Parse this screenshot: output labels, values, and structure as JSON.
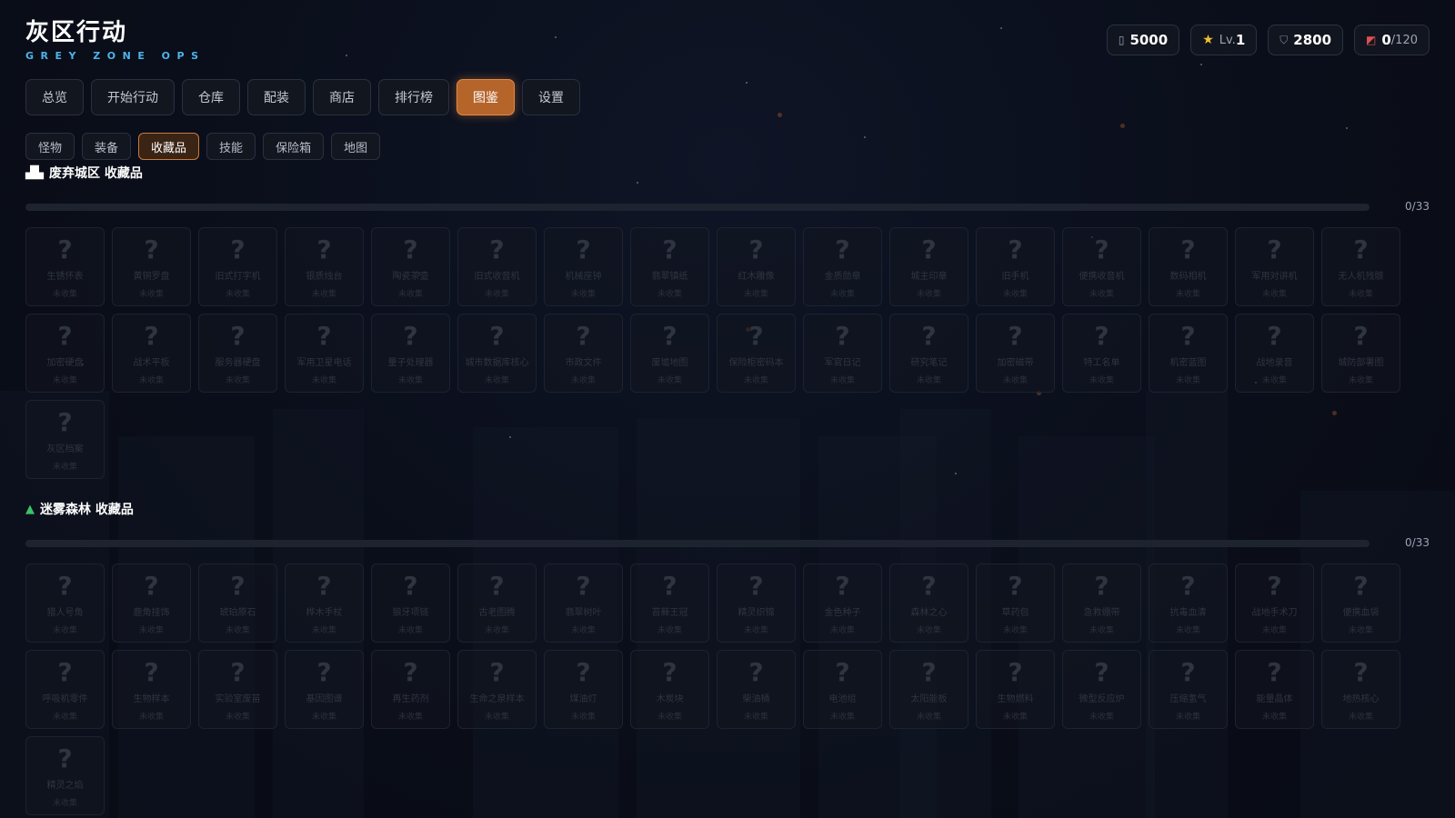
{
  "app": {
    "title": "灰区行动",
    "subtitle": "GREY ZONE OPS"
  },
  "stats": {
    "gold": "5000",
    "level_prefix": "Lv.",
    "level": "1",
    "shield": "2800",
    "bag_used": "0",
    "bag_capacity": "/120"
  },
  "main_tabs": [
    "总览",
    "开始行动",
    "仓库",
    "配装",
    "商店",
    "排行榜",
    "图鉴",
    "设置"
  ],
  "main_tab_active": "图鉴",
  "sub_tabs": [
    "怪物",
    "装备",
    "收藏品",
    "技能",
    "保险箱",
    "地图"
  ],
  "sub_tab_active": "收藏品",
  "sections": [
    {
      "title": "废弃城区 收藏品",
      "icon": "city-icon",
      "collected": 0,
      "total": 33,
      "count_text": "0/33",
      "items": [
        {
          "name": "生锈怀表",
          "status": "未收集"
        },
        {
          "name": "黄铜罗盘",
          "status": "未收集"
        },
        {
          "name": "旧式打字机",
          "status": "未收集"
        },
        {
          "name": "银质烛台",
          "status": "未收集"
        },
        {
          "name": "陶瓷茶壶",
          "status": "未收集"
        },
        {
          "name": "旧式收音机",
          "status": "未收集"
        },
        {
          "name": "机械座钟",
          "status": "未收集"
        },
        {
          "name": "翡翠镇纸",
          "status": "未收集"
        },
        {
          "name": "红木雕像",
          "status": "未收集"
        },
        {
          "name": "金质勋章",
          "status": "未收集"
        },
        {
          "name": "城主印章",
          "status": "未收集"
        },
        {
          "name": "旧手机",
          "status": "未收集"
        },
        {
          "name": "便携收音机",
          "status": "未收集"
        },
        {
          "name": "数码相机",
          "status": "未收集"
        },
        {
          "name": "军用对讲机",
          "status": "未收集"
        },
        {
          "name": "无人机残骸",
          "status": "未收集"
        },
        {
          "name": "加密硬盘",
          "status": "未收集"
        },
        {
          "name": "战术平板",
          "status": "未收集"
        },
        {
          "name": "服务器硬盘",
          "status": "未收集"
        },
        {
          "name": "军用卫星电话",
          "status": "未收集"
        },
        {
          "name": "量子处理器",
          "status": "未收集"
        },
        {
          "name": "城市数据库核心",
          "status": "未收集"
        },
        {
          "name": "市政文件",
          "status": "未收集"
        },
        {
          "name": "废墟地图",
          "status": "未收集"
        },
        {
          "name": "保险柜密码本",
          "status": "未收集"
        },
        {
          "name": "军官日记",
          "status": "未收集"
        },
        {
          "name": "研究笔记",
          "status": "未收集"
        },
        {
          "name": "加密磁带",
          "status": "未收集"
        },
        {
          "name": "特工名单",
          "status": "未收集"
        },
        {
          "name": "机密蓝图",
          "status": "未收集"
        },
        {
          "name": "战地录音",
          "status": "未收集"
        },
        {
          "name": "城防部署图",
          "status": "未收集"
        },
        {
          "name": "灰区档案",
          "status": "未收集"
        }
      ]
    },
    {
      "title": "迷雾森林 收藏品",
      "icon": "tree-icon",
      "collected": 0,
      "total": 33,
      "count_text": "0/33",
      "items": [
        {
          "name": "猎人号角",
          "status": "未收集"
        },
        {
          "name": "鹿角挂饰",
          "status": "未收集"
        },
        {
          "name": "琥珀原石",
          "status": "未收集"
        },
        {
          "name": "桦木手杖",
          "status": "未收集"
        },
        {
          "name": "狼牙项链",
          "status": "未收集"
        },
        {
          "name": "古老图腾",
          "status": "未收集"
        },
        {
          "name": "翡翠树叶",
          "status": "未收集"
        },
        {
          "name": "苔藓王冠",
          "status": "未收集"
        },
        {
          "name": "精灵织锦",
          "status": "未收集"
        },
        {
          "name": "金色种子",
          "status": "未收集"
        },
        {
          "name": "森林之心",
          "status": "未收集"
        },
        {
          "name": "草药包",
          "status": "未收集"
        },
        {
          "name": "急救绷带",
          "status": "未收集"
        },
        {
          "name": "抗毒血清",
          "status": "未收集"
        },
        {
          "name": "战地手术刀",
          "status": "未收集"
        },
        {
          "name": "便携血袋",
          "status": "未收集"
        },
        {
          "name": "呼吸机零件",
          "status": "未收集"
        },
        {
          "name": "生物样本",
          "status": "未收集"
        },
        {
          "name": "实验室废苗",
          "status": "未收集"
        },
        {
          "name": "基因图谱",
          "status": "未收集"
        },
        {
          "name": "再生药剂",
          "status": "未收集"
        },
        {
          "name": "生命之泉样本",
          "status": "未收集"
        },
        {
          "name": "煤油灯",
          "status": "未收集"
        },
        {
          "name": "木炭块",
          "status": "未收集"
        },
        {
          "name": "柴油桶",
          "status": "未收集"
        },
        {
          "name": "电池组",
          "status": "未收集"
        },
        {
          "name": "太阳能板",
          "status": "未收集"
        },
        {
          "name": "生物燃料",
          "status": "未收集"
        },
        {
          "name": "微型反应炉",
          "status": "未收集"
        },
        {
          "name": "压缩氢气",
          "status": "未收集"
        },
        {
          "name": "能量晶体",
          "status": "未收集"
        },
        {
          "name": "地热核心",
          "status": "未收集"
        },
        {
          "name": "精灵之焰",
          "status": "未收集"
        }
      ]
    }
  ],
  "unknown_glyph": "?"
}
